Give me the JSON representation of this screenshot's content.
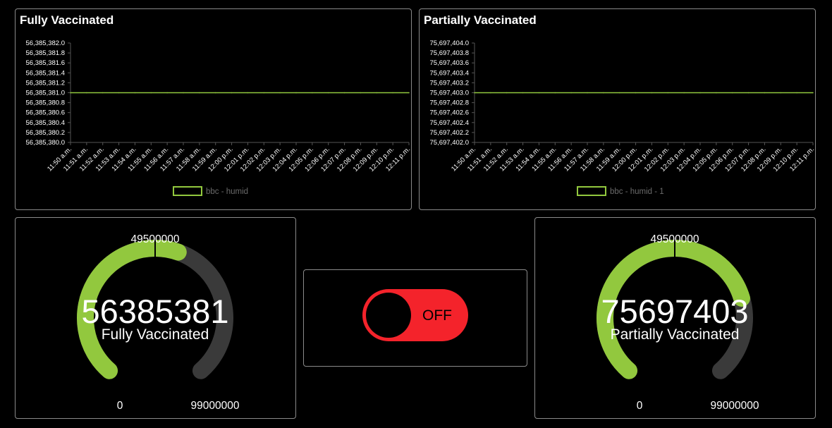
{
  "colors": {
    "accent": "#92c83e",
    "track": "#3a3a3a",
    "toggle_off": "#f4232b",
    "axis": "#555555"
  },
  "charts": [
    {
      "title": "Fully Vaccinated",
      "legend": "bbc - humid",
      "yticks": [
        "56,385,382.0",
        "56,385,381.8",
        "56,385,381.6",
        "56,385,381.4",
        "56,385,381.2",
        "56,385,381.0",
        "56,385,380.8",
        "56,385,380.6",
        "56,385,380.4",
        "56,385,380.2",
        "56,385,380.0"
      ]
    },
    {
      "title": "Partially Vaccinated",
      "legend": "bbc - humid - 1",
      "yticks": [
        "75,697,404.0",
        "75,697,403.8",
        "75,697,403.6",
        "75,697,403.4",
        "75,697,403.2",
        "75,697,403.0",
        "75,697,402.8",
        "75,697,402.6",
        "75,697,402.4",
        "75,697,402.2",
        "75,697,402.0"
      ]
    }
  ],
  "chart_data": [
    {
      "type": "line",
      "title": "Fully Vaccinated",
      "x": [
        "11:50 a.m.",
        "11:51 a.m.",
        "11:52 a.m.",
        "11:53 a.m.",
        "11:54 a.m.",
        "11:55 a.m.",
        "11:56 a.m.",
        "11:57 a.m.",
        "11:58 a.m.",
        "11:59 a.m.",
        "12:00 p.m.",
        "12:01 p.m.",
        "12:02 p.m.",
        "12:03 p.m.",
        "12:04 p.m.",
        "12:05 p.m.",
        "12:06 p.m.",
        "12:07 p.m.",
        "12:08 p.m.",
        "12:09 p.m.",
        "12:10 p.m.",
        "12:11 p.m."
      ],
      "series": [
        {
          "name": "bbc - humid",
          "values": [
            56385381,
            56385381,
            56385381,
            56385381,
            56385381,
            56385381,
            56385381,
            56385381,
            56385381,
            56385381,
            56385381,
            56385381,
            56385381,
            56385381,
            56385381,
            56385381,
            56385381,
            56385381,
            56385381,
            56385381,
            56385381,
            56385381
          ]
        }
      ],
      "ylim": [
        56385380.0,
        56385382.0
      ],
      "legend": "bottom"
    },
    {
      "type": "line",
      "title": "Partially Vaccinated",
      "x": [
        "11:50 a.m.",
        "11:51 a.m.",
        "11:52 a.m.",
        "11:53 a.m.",
        "11:54 a.m.",
        "11:55 a.m.",
        "11:56 a.m.",
        "11:57 a.m.",
        "11:58 a.m.",
        "11:59 a.m.",
        "12:00 p.m.",
        "12:01 p.m.",
        "12:02 p.m.",
        "12:03 p.m.",
        "12:04 p.m.",
        "12:05 p.m.",
        "12:06 p.m.",
        "12:07 p.m.",
        "12:08 p.m.",
        "12:09 p.m.",
        "12:10 p.m.",
        "12:11 p.m."
      ],
      "series": [
        {
          "name": "bbc - humid - 1",
          "values": [
            75697403,
            75697403,
            75697403,
            75697403,
            75697403,
            75697403,
            75697403,
            75697403,
            75697403,
            75697403,
            75697403,
            75697403,
            75697403,
            75697403,
            75697403,
            75697403,
            75697403,
            75697403,
            75697403,
            75697403,
            75697403,
            75697403
          ]
        }
      ],
      "ylim": [
        75697402.0,
        75697404.0
      ],
      "legend": "bottom"
    }
  ],
  "gauges": [
    {
      "value": 56385381,
      "value_text": "56385381",
      "label": "Fully Vaccinated",
      "min": 0,
      "max": 99000000,
      "min_text": "0",
      "mid_text": "49500000",
      "max_text": "99000000"
    },
    {
      "value": 75697403,
      "value_text": "75697403",
      "label": "Partially Vaccinated",
      "min": 0,
      "max": 99000000,
      "min_text": "0",
      "mid_text": "49500000",
      "max_text": "99000000"
    }
  ],
  "toggle": {
    "state": "OFF"
  }
}
